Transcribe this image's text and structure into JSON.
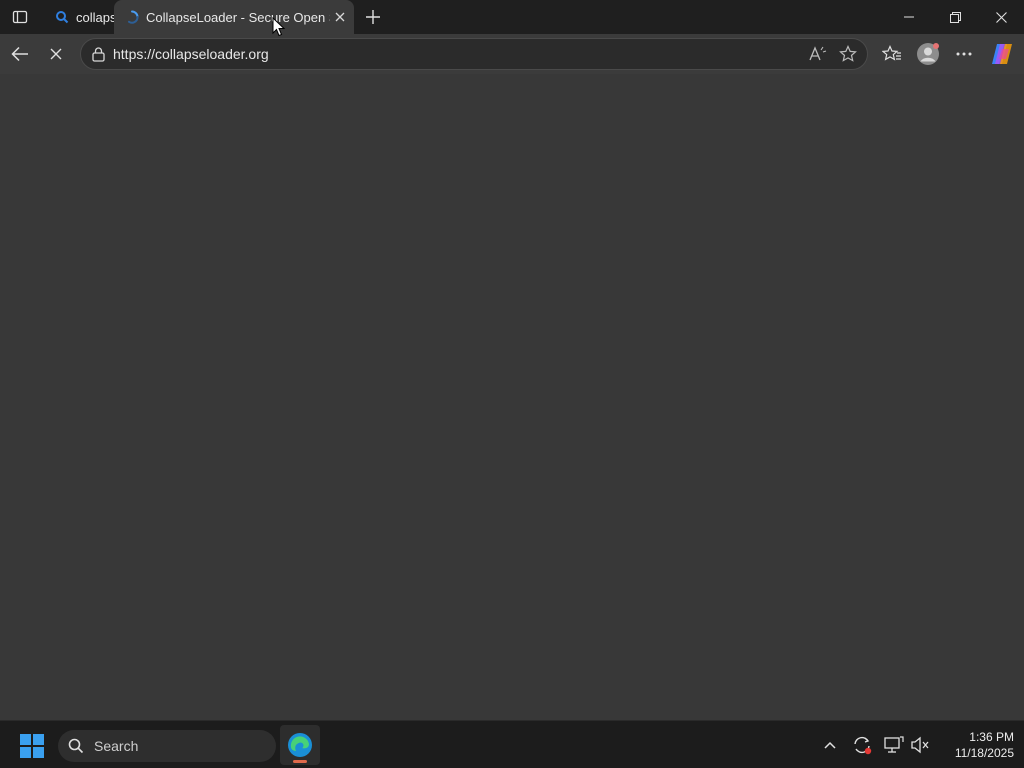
{
  "tabs": [
    {
      "title": "collaps",
      "favicon": "search-icon",
      "active": false
    },
    {
      "title": "CollapseLoader - Secure Open Source Client Loader",
      "favicon": "loading-spinner-icon",
      "active": true
    }
  ],
  "address": {
    "url": "https://collapseloader.org"
  },
  "taskbar": {
    "search_placeholder": "Search",
    "time": "1:36 PM",
    "date": "11/18/2025"
  },
  "colors": {
    "tabbar_bg": "#1f1f1f",
    "toolbar_bg": "#3b3b3b",
    "content_bg": "#383838",
    "taskbar_bg": "#1c1c1c",
    "accent": "#0078d4",
    "app_indicator": "#e06a4c"
  }
}
